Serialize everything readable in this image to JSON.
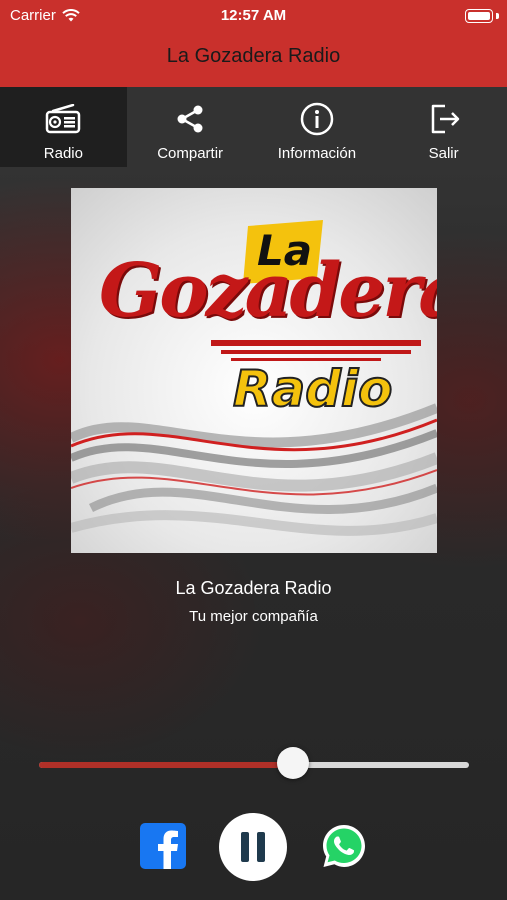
{
  "status_bar": {
    "carrier": "Carrier",
    "time": "12:57 AM"
  },
  "app": {
    "title": "La Gozadera Radio"
  },
  "tabs": [
    {
      "label": "Radio",
      "icon": "radio-icon",
      "active": true
    },
    {
      "label": "Compartir",
      "icon": "share-icon",
      "active": false
    },
    {
      "label": "Información",
      "icon": "info-icon",
      "active": false
    },
    {
      "label": "Salir",
      "icon": "exit-icon",
      "active": false
    }
  ],
  "player": {
    "station_name": "La Gozadera Radio",
    "slogan": "Tu mejor compañía",
    "volume": 0.59,
    "state": "playing"
  },
  "logo": {
    "line1": "La",
    "line2": "Gozadera",
    "line3": "Radio"
  },
  "colors": {
    "accent": "#c9302c",
    "tab_bg": "#333333",
    "tab_active_bg": "#1f1f1f",
    "facebook": "#1877f2",
    "whatsapp": "#25d366"
  }
}
